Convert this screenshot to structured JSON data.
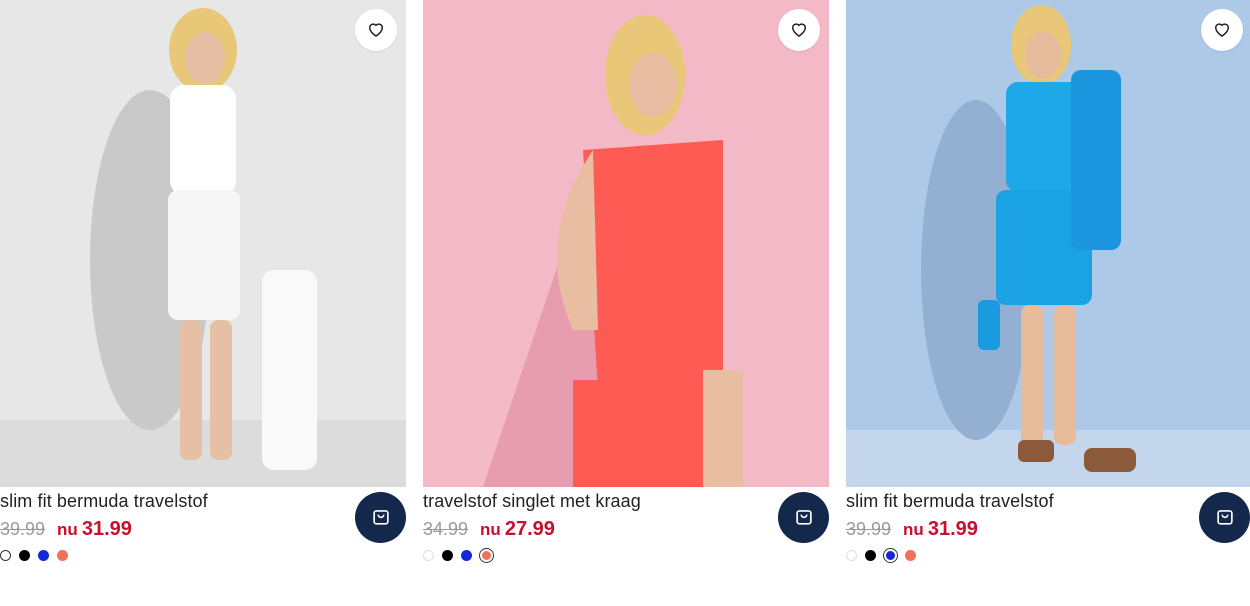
{
  "products": [
    {
      "title": "slim fit bermuda travelstof",
      "old_price": "39.99",
      "nu_label": "nu",
      "new_price": "31.99",
      "photo": {
        "background": "#e6e6e6",
        "garment": "#ffffff"
      },
      "swatches": [
        {
          "color": "#ffffff",
          "border": "#333333",
          "selected": false
        },
        {
          "color": "#000000",
          "border": "#000000",
          "selected": false
        },
        {
          "color": "#1428d9",
          "border": "#1428d9",
          "selected": false
        },
        {
          "color": "#f0705a",
          "border": "#f0705a",
          "selected": false
        }
      ]
    },
    {
      "title": "travelstof singlet met kraag",
      "old_price": "34.99",
      "nu_label": "nu",
      "new_price": "27.99",
      "photo": {
        "background": "#f2b8c4",
        "garment": "#ff5a5a"
      },
      "swatches": [
        {
          "color": "#ffffff",
          "border": "#dddddd",
          "selected": false
        },
        {
          "color": "#000000",
          "border": "#000000",
          "selected": false
        },
        {
          "color": "#1428d9",
          "border": "#1428d9",
          "selected": false
        },
        {
          "color": "#f0705a",
          "border": "#f0705a",
          "selected": true
        }
      ]
    },
    {
      "title": "slim fit bermuda travelstof",
      "old_price": "39.99",
      "nu_label": "nu",
      "new_price": "31.99",
      "photo": {
        "background": "#aec8e6",
        "garment": "#1fa8e6"
      },
      "swatches": [
        {
          "color": "#ffffff",
          "border": "#dddddd",
          "selected": false
        },
        {
          "color": "#000000",
          "border": "#000000",
          "selected": false
        },
        {
          "color": "#1428d9",
          "border": "#1428d9",
          "selected": true
        },
        {
          "color": "#f0705a",
          "border": "#f0705a",
          "selected": false
        }
      ]
    }
  ],
  "icons": {
    "favorite": "heart-icon",
    "cart": "shopping-bag-icon"
  },
  "colors": {
    "price_red": "#c8102e",
    "cart_button": "#14284b"
  }
}
